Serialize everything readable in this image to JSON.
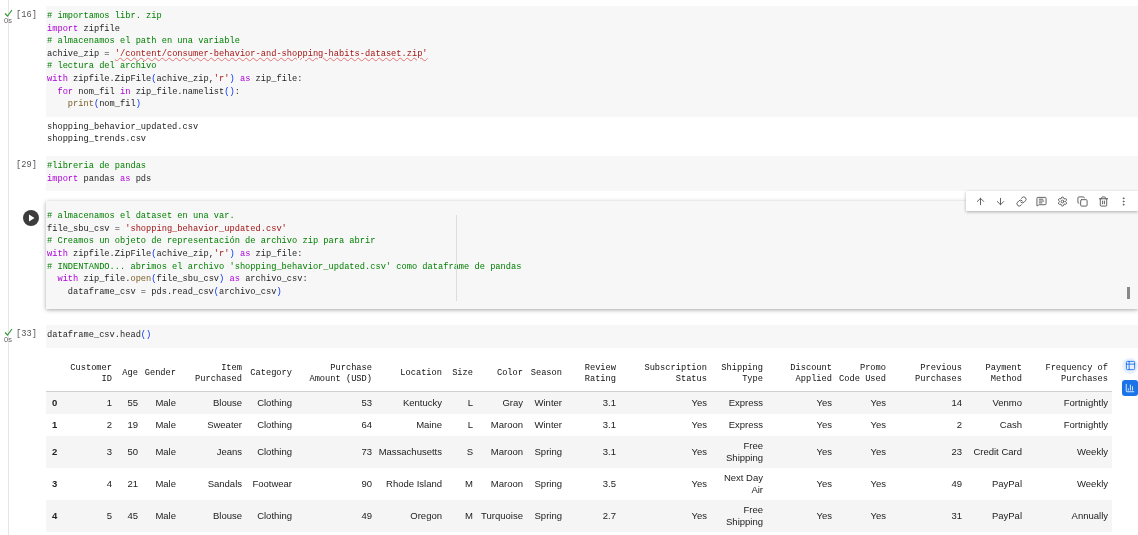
{
  "cells": [
    {
      "kind": "code",
      "count": "[16]",
      "executed": true,
      "time": "0s",
      "focused": false,
      "lines": [
        [
          {
            "kind": "comment",
            "text": "# importamos libr. zip"
          }
        ],
        [
          {
            "kind": "keyword",
            "text": "import"
          },
          {
            "kind": "plain",
            "text": " zipfile"
          }
        ],
        [
          {
            "kind": "comment",
            "text": "# almacenamos el path en una variable"
          }
        ],
        [
          {
            "kind": "plain",
            "text": "achive_zip = "
          },
          {
            "kind": "flagged_string",
            "text": "'/content/consumer-behavior-and-shopping-habits-dataset.zip'"
          }
        ],
        [
          {
            "kind": "comment",
            "text": "# lectura del archivo"
          }
        ],
        [
          {
            "kind": "keyword",
            "text": "with"
          },
          {
            "kind": "plain",
            "text": " zipfile.ZipFile"
          },
          {
            "kind": "bracket",
            "text": "("
          },
          {
            "kind": "plain",
            "text": "achive_zip,"
          },
          {
            "kind": "string",
            "text": "'r'"
          },
          {
            "kind": "bracket",
            "text": ") "
          },
          {
            "kind": "keyword",
            "text": "as"
          },
          {
            "kind": "plain",
            "text": " zip_file:"
          }
        ],
        [
          {
            "kind": "keyword",
            "text": "  for"
          },
          {
            "kind": "plain",
            "text": " nom_fil "
          },
          {
            "kind": "keyword",
            "text": "in"
          },
          {
            "kind": "plain",
            "text": " zip_file.namelist"
          },
          {
            "kind": "bracket",
            "text": "()"
          },
          {
            "kind": "plain",
            "text": ":"
          }
        ],
        [
          {
            "kind": "function",
            "text": "    print"
          },
          {
            "kind": "bracket",
            "text": "("
          },
          {
            "kind": "plain",
            "text": "nom_fil"
          },
          {
            "kind": "bracket",
            "text": ")"
          }
        ]
      ],
      "output": [
        "shopping_behavior_updated.csv",
        "shopping_trends.csv"
      ]
    },
    {
      "kind": "code",
      "count": "[29]",
      "executed": false,
      "focused": false,
      "lines": [
        [
          {
            "kind": "comment",
            "text": "#libreria de pandas"
          }
        ],
        [
          {
            "kind": "keyword",
            "text": "import"
          },
          {
            "kind": "plain",
            "text": " pandas "
          },
          {
            "kind": "keyword",
            "text": "as"
          },
          {
            "kind": "plain",
            "text": " pds"
          }
        ]
      ]
    },
    {
      "kind": "code",
      "executed": false,
      "focused": true,
      "lines": [
        [
          {
            "kind": "comment",
            "text": "# almacenamos el dataset en una var."
          }
        ],
        [
          {
            "kind": "plain",
            "text": "file_sbu_csv = "
          },
          {
            "kind": "string",
            "text": "'shopping_behavior_updated.csv'"
          }
        ],
        [
          {
            "kind": "comment",
            "text": "# Creamos un objeto de representación de archivo zip para abrir"
          }
        ],
        [
          {
            "kind": "keyword",
            "text": "with"
          },
          {
            "kind": "plain",
            "text": " zipfile.ZipFile"
          },
          {
            "kind": "bracket",
            "text": "("
          },
          {
            "kind": "plain",
            "text": "achive_zip,"
          },
          {
            "kind": "string",
            "text": "'r'"
          },
          {
            "kind": "bracket",
            "text": ") "
          },
          {
            "kind": "keyword",
            "text": "as"
          },
          {
            "kind": "plain",
            "text": " zip_file:"
          }
        ],
        [
          {
            "kind": "comment",
            "text": "# INDENTANDO... abrimos el archivo 'shopping_behavior_updated.csv' como dataframe de pandas"
          }
        ],
        [
          {
            "kind": "keyword",
            "text": "  with"
          },
          {
            "kind": "plain",
            "text": " zip_file."
          },
          {
            "kind": "function",
            "text": "open"
          },
          {
            "kind": "bracket",
            "text": "("
          },
          {
            "kind": "plain",
            "text": "file_sbu_csv"
          },
          {
            "kind": "bracket",
            "text": ") "
          },
          {
            "kind": "keyword",
            "text": "as"
          },
          {
            "kind": "plain",
            "text": " archivo_csv:"
          }
        ],
        [
          {
            "kind": "plain",
            "text": "    dataframe_csv = pds.read_csv"
          },
          {
            "kind": "bracket",
            "text": "("
          },
          {
            "kind": "plain",
            "text": "archivo_csv"
          },
          {
            "kind": "bracket",
            "text": ")"
          }
        ]
      ]
    },
    {
      "kind": "code",
      "count": "[33]",
      "executed": true,
      "time": "0s",
      "focused": false,
      "lines": [
        [
          {
            "kind": "plain",
            "text": "dataframe_csv.head"
          },
          {
            "kind": "bracket",
            "text": "()"
          }
        ]
      ],
      "table": {
        "columns": [
          "Customer ID",
          "Age",
          "Gender",
          "Item Purchased",
          "Category",
          "Purchase Amount (USD)",
          "Location",
          "Size",
          "Color",
          "Season",
          "Review Rating",
          "Subscription Status",
          "Shipping Type",
          "Discount Applied",
          "Promo Code Used",
          "Previous Purchases",
          "Payment Method",
          "Frequency of Purchases"
        ],
        "rows": [
          {
            "index": "0",
            "cells": [
              "1",
              "55",
              "Male",
              "Blouse",
              "Clothing",
              "53",
              "Kentucky",
              "L",
              "Gray",
              "Winter",
              "3.1",
              "Yes",
              "Express",
              "Yes",
              "Yes",
              "14",
              "Venmo",
              "Fortnightly"
            ]
          },
          {
            "index": "1",
            "cells": [
              "2",
              "19",
              "Male",
              "Sweater",
              "Clothing",
              "64",
              "Maine",
              "L",
              "Maroon",
              "Winter",
              "3.1",
              "Yes",
              "Express",
              "Yes",
              "Yes",
              "2",
              "Cash",
              "Fortnightly"
            ]
          },
          {
            "index": "2",
            "cells": [
              "3",
              "50",
              "Male",
              "Jeans",
              "Clothing",
              "73",
              "Massachusetts",
              "S",
              "Maroon",
              "Spring",
              "3.1",
              "Yes",
              "Free Shipping",
              "Yes",
              "Yes",
              "23",
              "Credit Card",
              "Weekly"
            ]
          },
          {
            "index": "3",
            "cells": [
              "4",
              "21",
              "Male",
              "Sandals",
              "Footwear",
              "90",
              "Rhode Island",
              "M",
              "Maroon",
              "Spring",
              "3.5",
              "Yes",
              "Next Day Air",
              "Yes",
              "Yes",
              "49",
              "PayPal",
              "Weekly"
            ]
          },
          {
            "index": "4",
            "cells": [
              "5",
              "45",
              "Male",
              "Blouse",
              "Clothing",
              "49",
              "Oregon",
              "M",
              "Turquoise",
              "Spring",
              "2.7",
              "Yes",
              "Free Shipping",
              "Yes",
              "Yes",
              "31",
              "PayPal",
              "Annually"
            ]
          }
        ]
      }
    }
  ]
}
